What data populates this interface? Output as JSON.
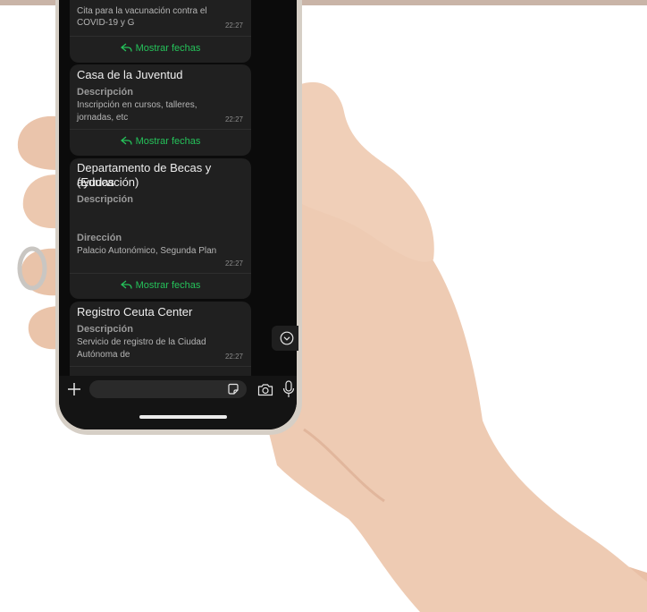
{
  "messages": [
    {
      "line1": "Cita para la vacunación contra el",
      "line2": "COVID-19 y G",
      "time": "22:27",
      "action": "Mostrar fechas"
    },
    {
      "title": "Casa de la Juventud",
      "desc_label": "Descripción",
      "desc_line1": "Inscripción en cursos, talleres,",
      "desc_line2": "jornadas, etc",
      "time": "22:27",
      "action": "Mostrar fechas"
    },
    {
      "title_line1": "Departamento de Becas y ayudas",
      "title_line2": "(Educación)",
      "desc_label": "Descripción",
      "addr_label": "Dirección",
      "addr_text": "Palacio Autonómico, Segunda Plan",
      "time": "22:27",
      "action": "Mostrar fechas"
    },
    {
      "title": "Registro Ceuta Center",
      "desc_label": "Descripción",
      "desc_line1": "Servicio de registro de la Ciudad",
      "desc_line2": "Autónoma de",
      "time": "22:27"
    }
  ],
  "composer": {
    "input_placeholder": ""
  },
  "icons": {
    "add": "plus-icon",
    "sticker": "sticker-icon",
    "camera": "camera-icon",
    "mic": "microphone-icon",
    "scroll": "chevron-down-circle-icon",
    "reply": "reply-icon"
  },
  "colors": {
    "accent": "#25c25a",
    "bubble": "#202020",
    "background": "#0b0b0b"
  }
}
